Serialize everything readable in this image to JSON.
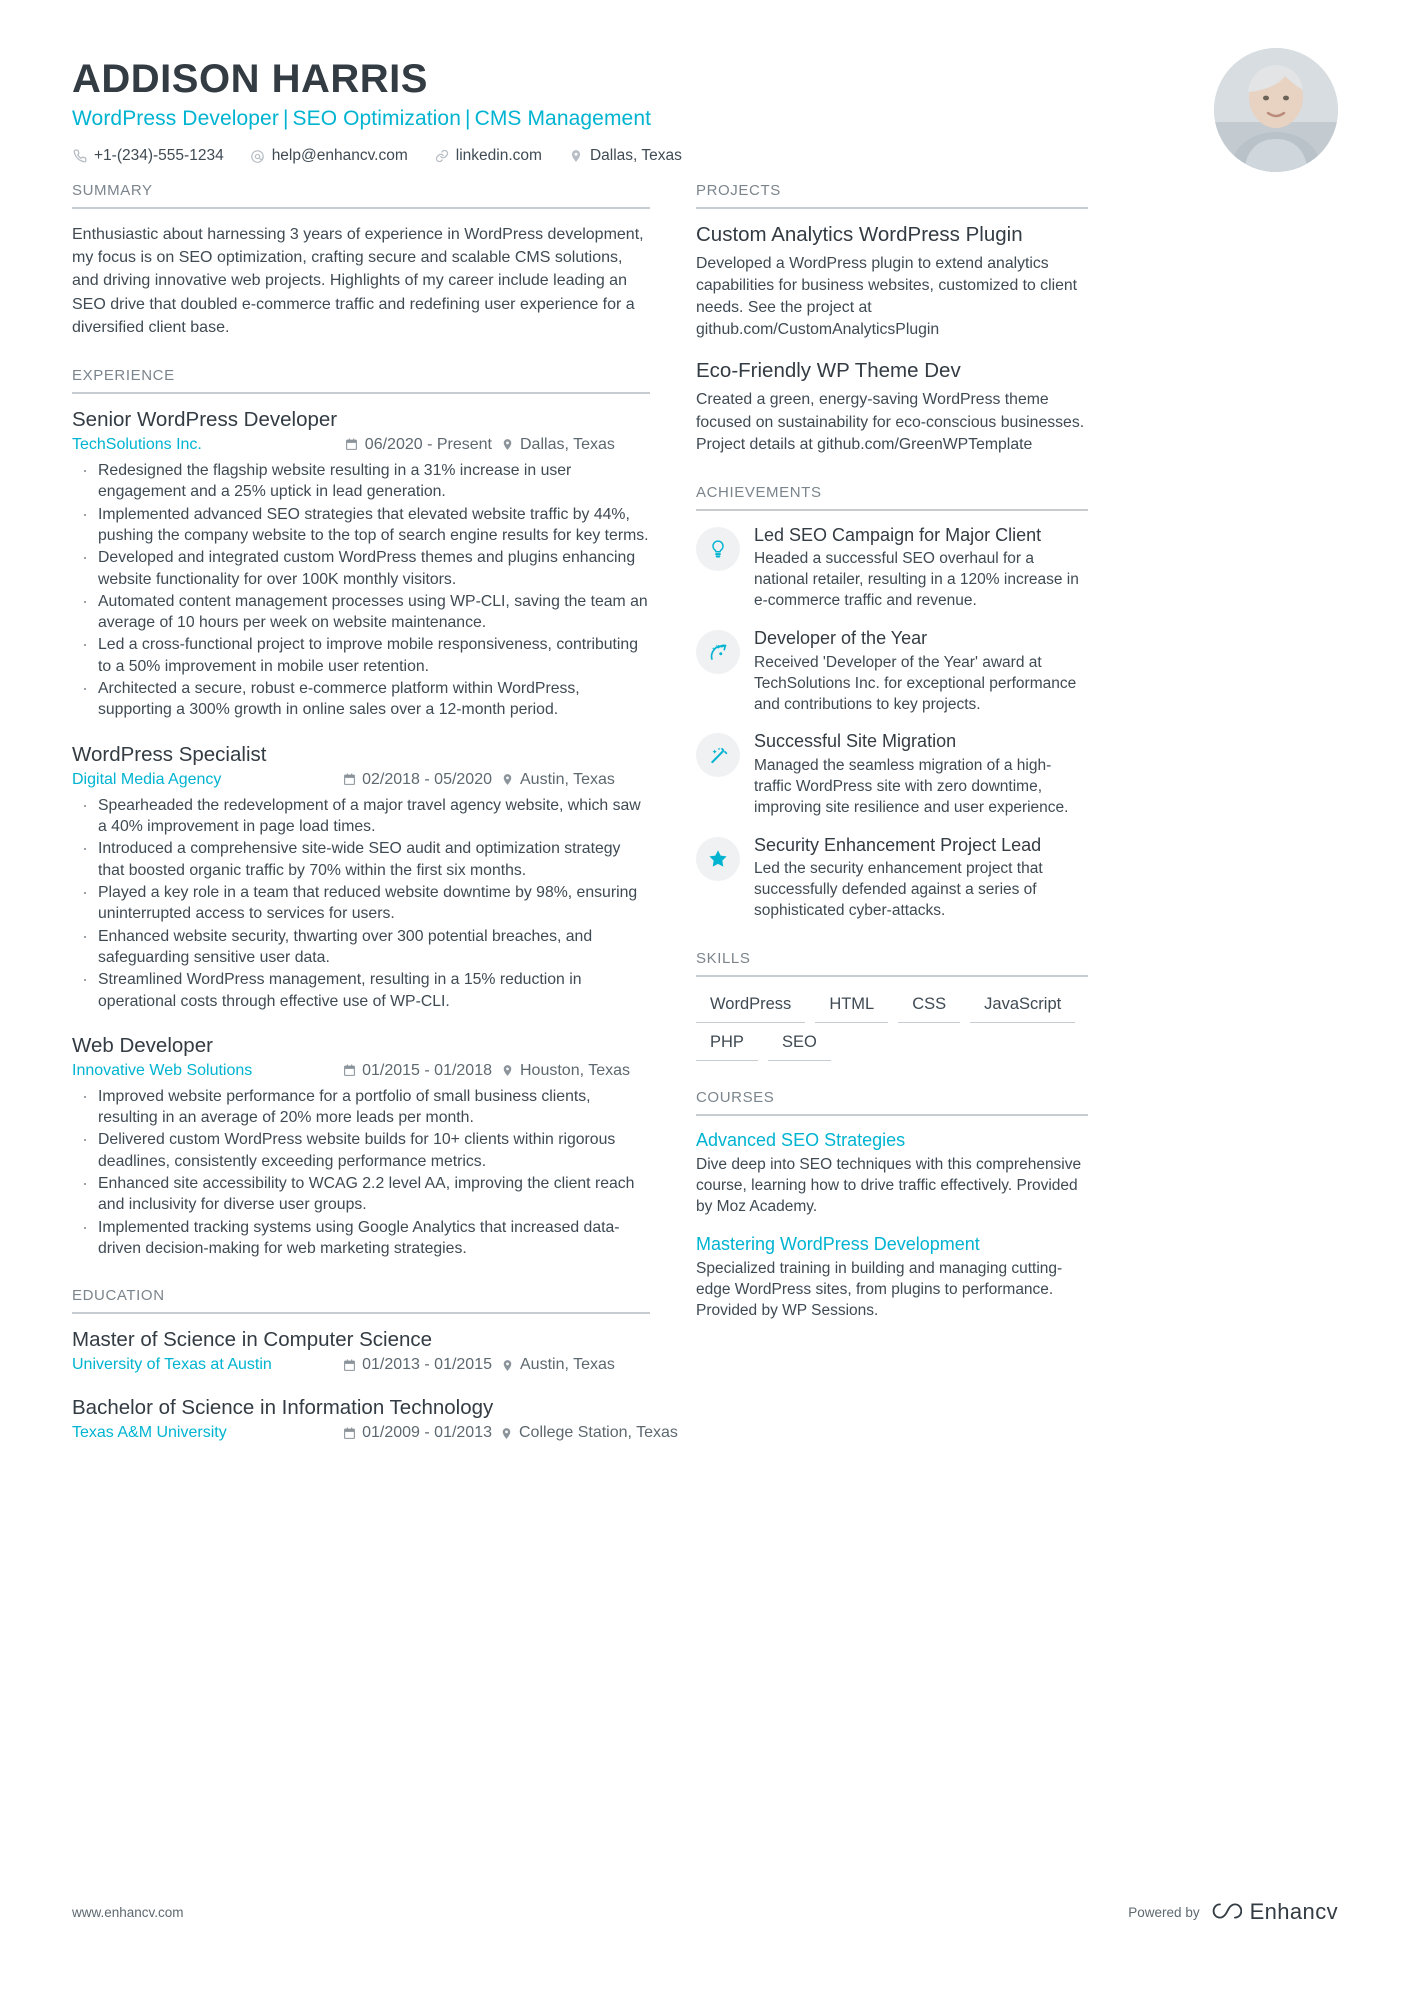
{
  "header": {
    "name": "ADDISON HARRIS",
    "headline_parts": [
      "WordPress Developer",
      "SEO Optimization",
      "CMS Management"
    ],
    "contacts": [
      {
        "icon": "phone-icon",
        "text": "+1-(234)-555-1234"
      },
      {
        "icon": "email-icon",
        "text": "help@enhancv.com"
      },
      {
        "icon": "link-icon",
        "text": "linkedin.com"
      },
      {
        "icon": "location-icon",
        "text": "Dallas, Texas"
      }
    ],
    "avatar_alt": "profile-photo"
  },
  "summary": {
    "title": "SUMMARY",
    "text": "Enthusiastic about harnessing 3 years of experience in WordPress development, my focus is on SEO optimization, crafting secure and scalable CMS solutions, and driving innovative web projects. Highlights of my career include leading an SEO drive that doubled e-commerce traffic and redefining user experience for a diversified client base."
  },
  "experience": {
    "title": "EXPERIENCE",
    "entries": [
      {
        "role": "Senior WordPress Developer",
        "company": "TechSolutions Inc.",
        "dates": "06/2020 - Present",
        "location": "Dallas, Texas",
        "bullets": [
          "Redesigned the flagship website resulting in a 31% increase in user engagement and a 25% uptick in lead generation.",
          "Implemented advanced SEO strategies that elevated website traffic by 44%, pushing the company website to the top of search engine results for key terms.",
          "Developed and integrated custom WordPress themes and plugins enhancing website functionality for over 100K monthly visitors.",
          "Automated content management processes using WP-CLI, saving the team an average of 10 hours per week on website maintenance.",
          "Led a cross-functional project to improve mobile responsiveness, contributing to a 50% improvement in mobile user retention.",
          "Architected a secure, robust e-commerce platform within WordPress, supporting a 300% growth in online sales over a 12-month period."
        ]
      },
      {
        "role": "WordPress Specialist",
        "company": "Digital Media Agency",
        "dates": "02/2018 - 05/2020",
        "location": "Austin, Texas",
        "bullets": [
          "Spearheaded the redevelopment of a major travel agency website, which saw a 40% improvement in page load times.",
          "Introduced a comprehensive site-wide SEO audit and optimization strategy that boosted organic traffic by 70% within the first six months.",
          "Played a key role in a team that reduced website downtime by 98%, ensuring uninterrupted access to services for users.",
          "Enhanced website security, thwarting over 300 potential breaches, and safeguarding sensitive user data.",
          "Streamlined WordPress management, resulting in a 15% reduction in operational costs through effective use of WP-CLI."
        ]
      },
      {
        "role": "Web Developer",
        "company": "Innovative Web Solutions",
        "dates": "01/2015 - 01/2018",
        "location": "Houston, Texas",
        "bullets": [
          "Improved website performance for a portfolio of small business clients, resulting in an average of 20% more leads per month.",
          "Delivered custom WordPress website builds for 10+ clients within rigorous deadlines, consistently exceeding performance metrics.",
          "Enhanced site accessibility to WCAG 2.2 level AA, improving the client reach and inclusivity for diverse user groups.",
          "Implemented tracking systems using Google Analytics that increased data-driven decision-making for web marketing strategies."
        ]
      }
    ]
  },
  "education": {
    "title": "EDUCATION",
    "entries": [
      {
        "degree": "Master of Science in Computer Science",
        "school": "University of Texas at Austin",
        "dates": "01/2013 - 01/2015",
        "location": "Austin, Texas"
      },
      {
        "degree": "Bachelor of Science in Information Technology",
        "school": "Texas A&M University",
        "dates": "01/2009 - 01/2013",
        "location": "College Station, Texas"
      }
    ]
  },
  "projects": {
    "title": "PROJECTS",
    "items": [
      {
        "name": "Custom Analytics WordPress Plugin",
        "description": "Developed a WordPress plugin to extend analytics capabilities for business websites, customized to client needs. See the project at github.com/CustomAnalyticsPlugin"
      },
      {
        "name": "Eco-Friendly WP Theme Dev",
        "description": "Created a green, energy-saving WordPress theme focused on sustainability for eco-conscious businesses. Project details at github.com/GreenWPTemplate"
      }
    ]
  },
  "achievements": {
    "title": "ACHIEVEMENTS",
    "items": [
      {
        "icon": "lightbulb-icon",
        "title": "Led SEO Campaign for Major Client",
        "description": "Headed a successful SEO overhaul for a national retailer, resulting in a 120% increase in e-commerce traffic and revenue."
      },
      {
        "icon": "rocket-icon",
        "title": "Developer of the Year",
        "description": "Received 'Developer of the Year' award at TechSolutions Inc. for exceptional performance and contributions to key projects."
      },
      {
        "icon": "magic-wand-icon",
        "title": "Successful Site Migration",
        "description": "Managed the seamless migration of a high-traffic WordPress site with zero downtime, improving site resilience and user experience."
      },
      {
        "icon": "star-icon",
        "title": "Security Enhancement Project Lead",
        "description": "Led the security enhancement project that successfully defended against a series of sophisticated cyber-attacks."
      }
    ]
  },
  "skills": {
    "title": "SKILLS",
    "items": [
      "WordPress",
      "HTML",
      "CSS",
      "JavaScript",
      "PHP",
      "SEO"
    ]
  },
  "courses": {
    "title": "COURSES",
    "items": [
      {
        "name": "Advanced SEO Strategies",
        "description": "Dive deep into SEO techniques with this comprehensive course, learning how to drive traffic effectively. Provided by Moz Academy."
      },
      {
        "name": "Mastering WordPress Development",
        "description": "Specialized training in building and managing cutting-edge WordPress sites, from plugins to performance. Provided by WP Sessions."
      }
    ]
  },
  "footer": {
    "site": "www.enhancv.com",
    "powered_by": "Powered by",
    "brand": "Enhancv"
  },
  "colors": {
    "accent": "#00b4d1",
    "heading": "#333b43",
    "body": "#3f4a53",
    "muted": "#7b858d",
    "rule": "#c7ccd1"
  }
}
